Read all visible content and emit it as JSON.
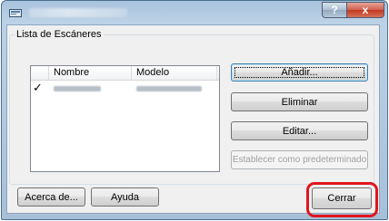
{
  "window": {
    "title": ""
  },
  "titlebar": {
    "help_label": "?",
    "close_label": "x"
  },
  "group": {
    "label": "Lista de Escáneres"
  },
  "list": {
    "columns": [
      "Nombre",
      "Modelo"
    ],
    "rows": [
      {
        "checked": "✓",
        "name": "",
        "model": ""
      }
    ]
  },
  "buttons": {
    "add": "Añadir...",
    "delete": "Eliminar",
    "edit": "Editar...",
    "set_default": "Establecer como predeterminado",
    "about": "Acerca de...",
    "help": "Ayuda",
    "close": "Cerrar"
  },
  "colors": {
    "highlight": "#e0151e"
  }
}
